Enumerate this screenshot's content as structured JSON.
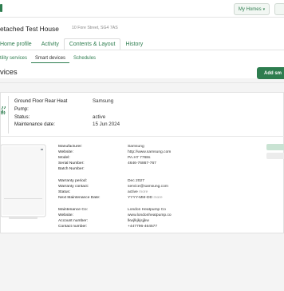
{
  "topbar": {
    "my_homes_label": "My Homes",
    "my_homes_caret": "▾"
  },
  "house": {
    "title": "etached Test House",
    "address": "10 Fore Street, SG4 7AS"
  },
  "tabs": [
    {
      "label": "Home profile",
      "active": false
    },
    {
      "label": "Activity",
      "active": false
    },
    {
      "label": "Contents & Layout",
      "active": true
    },
    {
      "label": "History",
      "active": false
    }
  ],
  "subtabs": [
    {
      "label": "tility services",
      "active": false
    },
    {
      "label": "Smart devices",
      "active": true
    },
    {
      "label": "Schedules",
      "active": false
    }
  ],
  "section": {
    "title": "vices",
    "add_label": "Add sm"
  },
  "device": {
    "summary": [
      {
        "label": "Ground Floor Rear Heat",
        "value": "Samsung"
      },
      {
        "label": "Pump:",
        "value": ""
      },
      {
        "label": "Status:",
        "value": "active"
      },
      {
        "label": "Maintenance date:",
        "value": "15 Jun 2024"
      }
    ],
    "details": [
      {
        "label": "Manufacturer:",
        "value": "Samsung",
        "style": ""
      },
      {
        "label": "Website:",
        "value": "http://www.samsung.com",
        "style": ""
      },
      {
        "label": "Model:",
        "value": "PA.H7 7768s",
        "style": ""
      },
      {
        "label": "Serial Number:",
        "value": "4646-76867-767",
        "style": ""
      },
      {
        "label": "Batch Number:",
        "value": "",
        "style": ""
      },
      {
        "label": "Warranty period:",
        "value": "Dec 2027",
        "style": ""
      },
      {
        "label": "Warranty contact:",
        "value": "service@samsung.com",
        "style": ""
      },
      {
        "label": "Status:",
        "value": "active",
        "suffix": "more",
        "style": ""
      },
      {
        "label": "Next Maintenance Date:",
        "value": "YYYY-MM-DD",
        "suffix": "more",
        "style": ""
      },
      {
        "label": "Maintenance Co:",
        "value": "London Heatpump Co",
        "style": ""
      },
      {
        "label": "Website:",
        "value": "www.londonheatpump.co",
        "style": ""
      },
      {
        "label": "Account number:",
        "value": "lkwjlkjkjsjjkw",
        "style": ""
      },
      {
        "label": "Contact number:",
        "value": "+447796-464577",
        "style": ""
      }
    ]
  },
  "colors": {
    "brand": "#2e7d4f",
    "side_button_primary": "#c9e3d3",
    "side_button_secondary": "#ececec"
  }
}
